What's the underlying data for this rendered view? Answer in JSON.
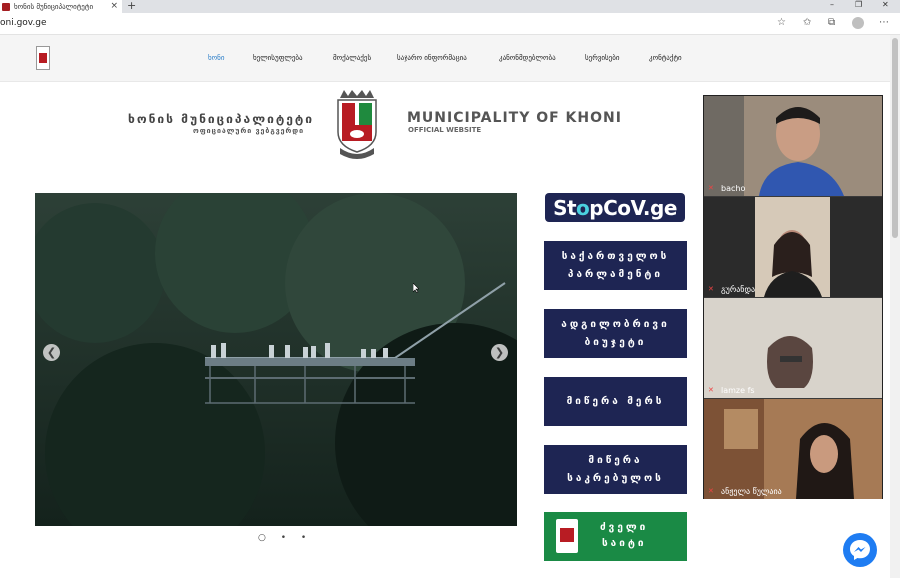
{
  "browser": {
    "tab_title": "ხონის მუნიციპალიტეტი",
    "tab_close": "×",
    "new_tab": "+",
    "url": "oni.gov.ge",
    "win_min": "–",
    "win_max": "❐",
    "win_close": "✕",
    "more": "⋯"
  },
  "nav": {
    "items": [
      "ხონი",
      "ხელისუფლება",
      "მოქალაქეს",
      "საჯარო ინფორმაცია",
      "კანონმდებლობა",
      "სერვისები",
      "კონტაქტი"
    ]
  },
  "header": {
    "title_geo": "ხონის მუნიციპალიტეტი",
    "subtitle_geo": "ოფიციალური ვებგვერდი",
    "title_en": "MUNICIPALITY OF KHONI",
    "subtitle_en": "OFFICIAL WEBSITE"
  },
  "slider": {
    "prev": "❮",
    "next": "❯",
    "dots": "○ • •"
  },
  "sidebar": {
    "stopcov_a": "St",
    "stopcov_o": "o",
    "stopcov_b": "pCoV.ge",
    "parliament_1": "საქართველოს",
    "parliament_2": "პარლამენტი",
    "budget_1": "ადგილობრივი",
    "budget_2": "ბიუჯეტი",
    "mayor": "მიწერა მერს",
    "council_1": "მიწერა",
    "council_2": "საკრებულოს",
    "oldsite_1": "ძველი",
    "oldsite_2": "საიტი"
  },
  "video_call": {
    "participants": [
      "bacho",
      "გურანდა",
      "lamze fs",
      "ანჟელა წულაია"
    ]
  }
}
